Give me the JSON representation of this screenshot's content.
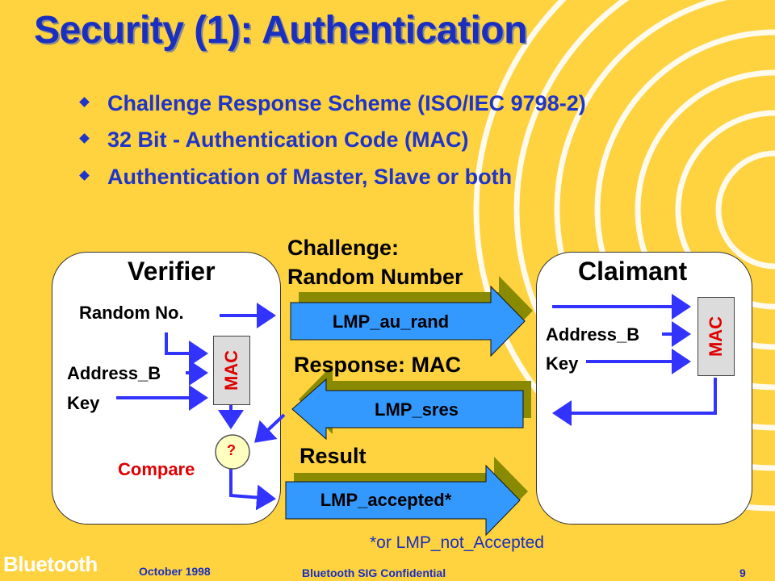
{
  "title": "Security (1): Authentication",
  "bullets": [
    "Challenge Response Scheme (ISO/IEC 9798-2)",
    "32 Bit - Authentication Code (MAC)",
    "Authentication of Master, Slave or both"
  ],
  "verifier": {
    "heading": "Verifier",
    "random_no": "Random No.",
    "address": "Address_B",
    "key": "Key",
    "mac": "MAC",
    "compare_symbol": "?",
    "compare": "Compare"
  },
  "claimant": {
    "heading": "Claimant",
    "address": "Address_B",
    "key": "Key",
    "mac": "MAC"
  },
  "flow": {
    "challenge_line1": "Challenge:",
    "challenge_line2": "Random Number",
    "au_rand": "LMP_au_rand",
    "response": "Response: MAC",
    "sres": "LMP_sres",
    "result": "Result",
    "accepted": "LMP_accepted*",
    "footnote": "*or LMP_not_Accepted"
  },
  "footer": {
    "brand": "Bluetooth",
    "date": "October 1998",
    "confidential": "Bluetooth SIG Confidential",
    "page": "9"
  },
  "colors": {
    "background": "#FFD23F",
    "title": "#1a2fbf",
    "arrow_fill": "#3399ff",
    "arrow_shadow": "#8a8a00",
    "connector": "#3333ff",
    "mac_text": "#e00000",
    "compare_text": "#e00000"
  }
}
